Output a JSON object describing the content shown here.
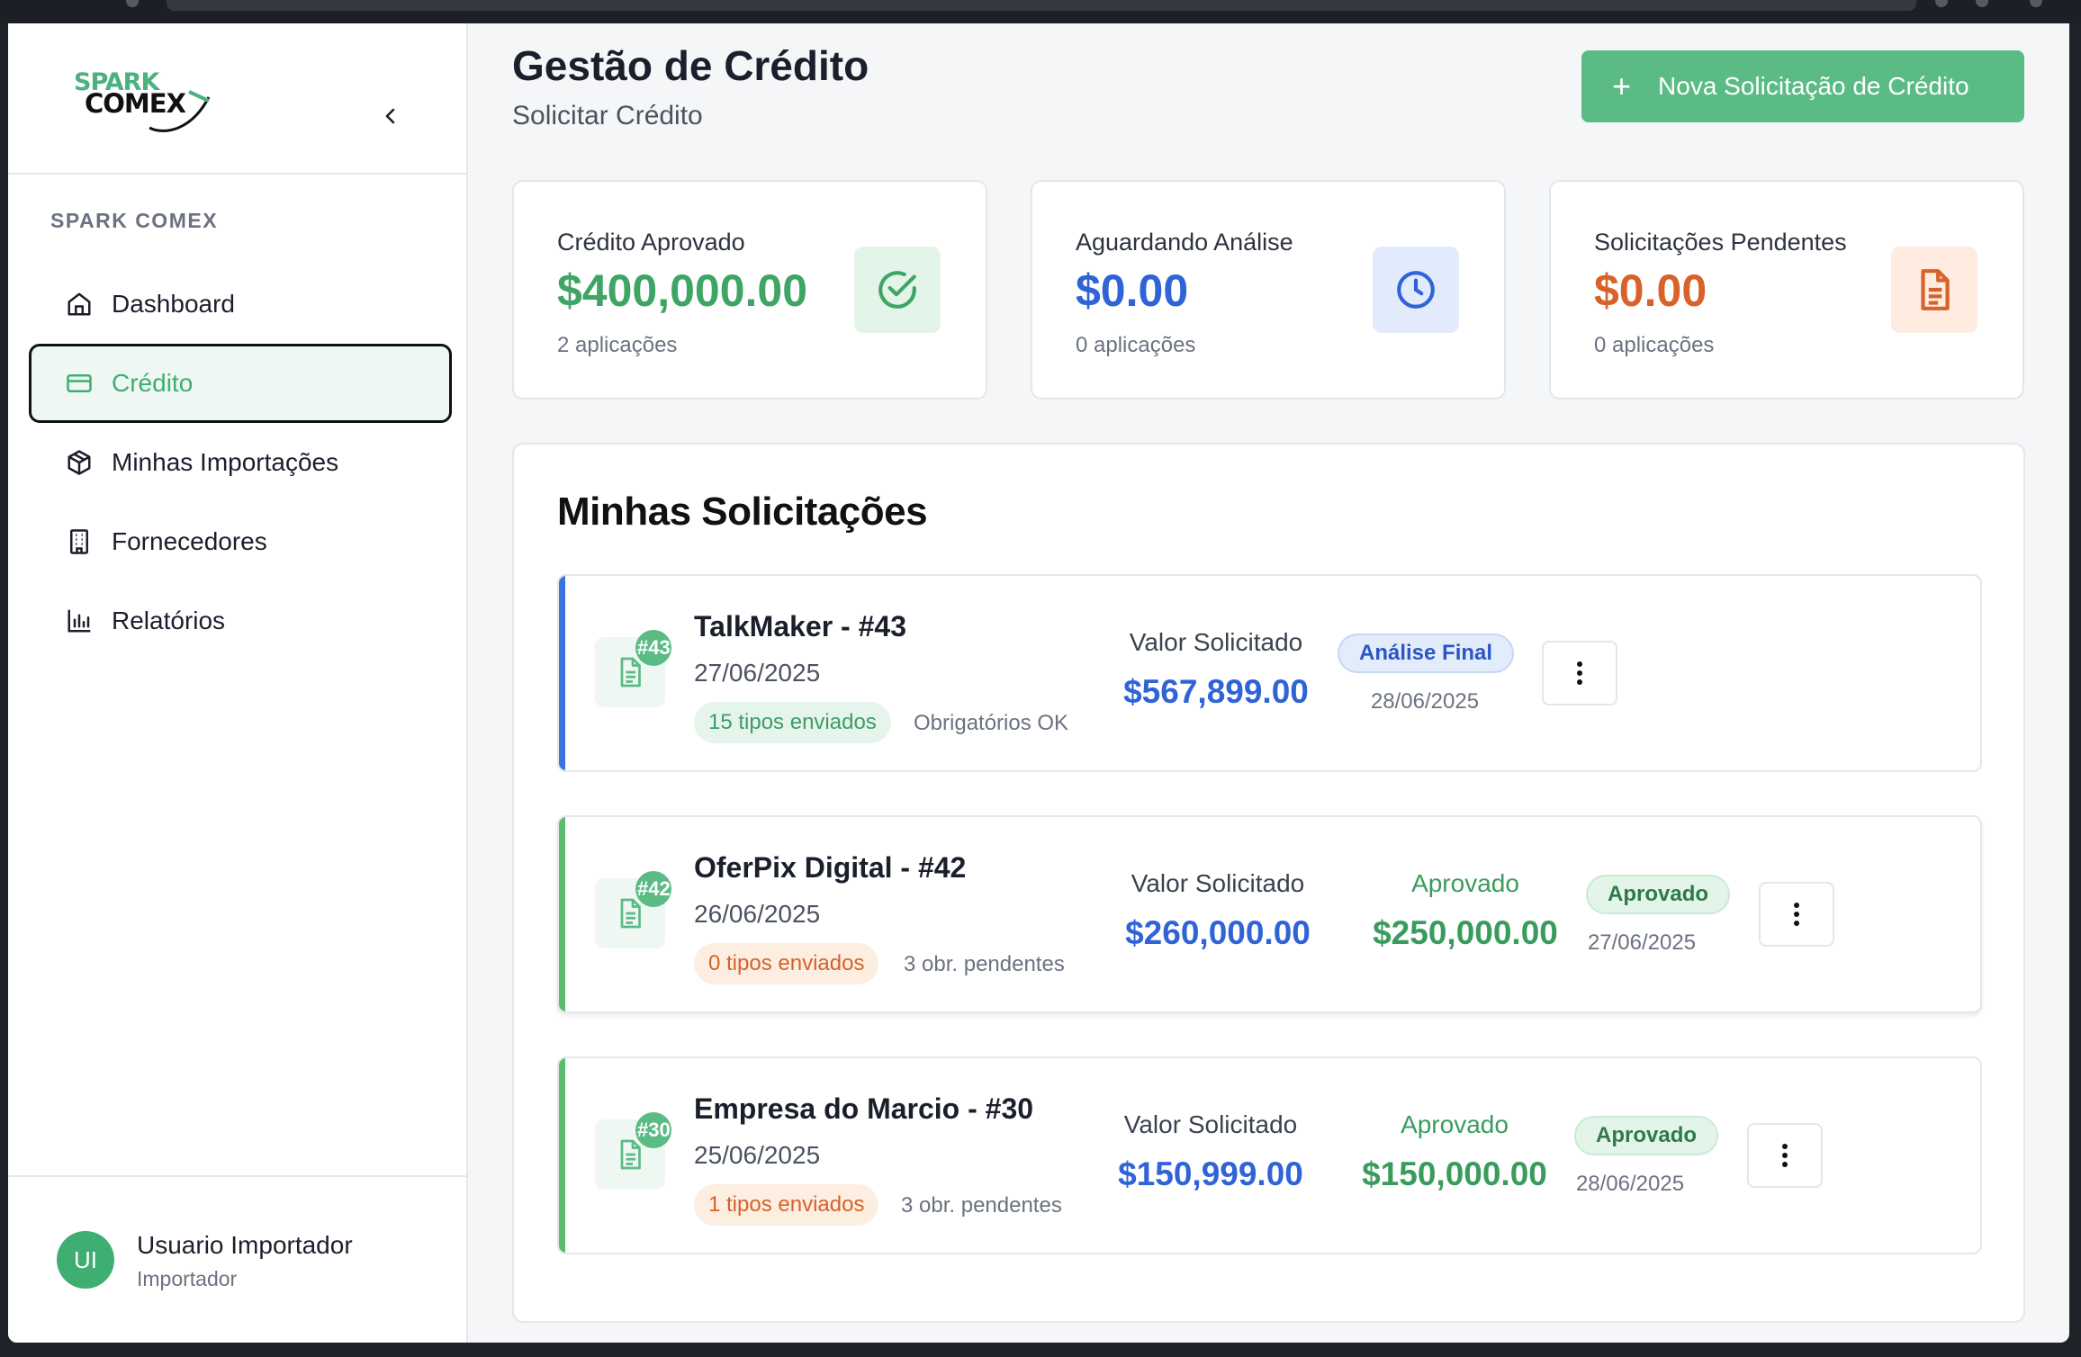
{
  "brand": {
    "line1": "SPARK",
    "line2": "COMEX"
  },
  "sidebar": {
    "section_label": "SPARK COMEX",
    "items": [
      {
        "label": "Dashboard",
        "icon": "home-icon"
      },
      {
        "label": "Crédito",
        "icon": "credit-card-icon",
        "active": true
      },
      {
        "label": "Minhas Importações",
        "icon": "package-icon"
      },
      {
        "label": "Fornecedores",
        "icon": "building-icon"
      },
      {
        "label": "Relatórios",
        "icon": "bar-chart-icon"
      }
    ],
    "user": {
      "initials": "UI",
      "name": "Usuario Importador",
      "role": "Importador"
    }
  },
  "header": {
    "title": "Gestão de Crédito",
    "subtitle": "Solicitar Crédito",
    "new_button": "Nova Solicitação de Crédito"
  },
  "stats": [
    {
      "label": "Crédito Aprovado",
      "value": "$400,000.00",
      "sub": "2 aplicações",
      "color": "#3fa564",
      "icon": "check-circle-icon"
    },
    {
      "label": "Aguardando Análise",
      "value": "$0.00",
      "sub": "0 aplicações",
      "color": "#2f63d6",
      "icon": "clock-icon"
    },
    {
      "label": "Solicitações Pendentes",
      "value": "$0.00",
      "sub": "0 aplicações",
      "color": "#d9622a",
      "icon": "document-icon"
    }
  ],
  "requests": {
    "title": "Minhas Solicitações",
    "value_label": "Valor Solicitado",
    "approved_label": "Aprovado",
    "items": [
      {
        "badge": "#43",
        "title": "TalkMaker - #43",
        "date": "27/06/2025",
        "docs": "15 tipos enviados",
        "docs_note": "Obrigatórios OK",
        "requested": "$567,899.00",
        "approved": null,
        "status": "Análise Final",
        "status_date": "28/06/2025"
      },
      {
        "badge": "#42",
        "title": "OferPix Digital - #42",
        "date": "26/06/2025",
        "docs": "0 tipos enviados",
        "docs_note": "3 obr. pendentes",
        "requested": "$260,000.00",
        "approved": "$250,000.00",
        "status": "Aprovado",
        "status_date": "27/06/2025"
      },
      {
        "badge": "#30",
        "title": "Empresa do Marcio - #30",
        "date": "25/06/2025",
        "docs": "1 tipos enviados",
        "docs_note": "3 obr. pendentes",
        "requested": "$150,999.00",
        "approved": "$150,000.00",
        "status": "Aprovado",
        "status_date": "28/06/2025"
      }
    ]
  },
  "colors": {
    "accent": "#5bbb85",
    "blue": "#2f63d6",
    "green": "#3fa564",
    "orange": "#d9622a"
  }
}
